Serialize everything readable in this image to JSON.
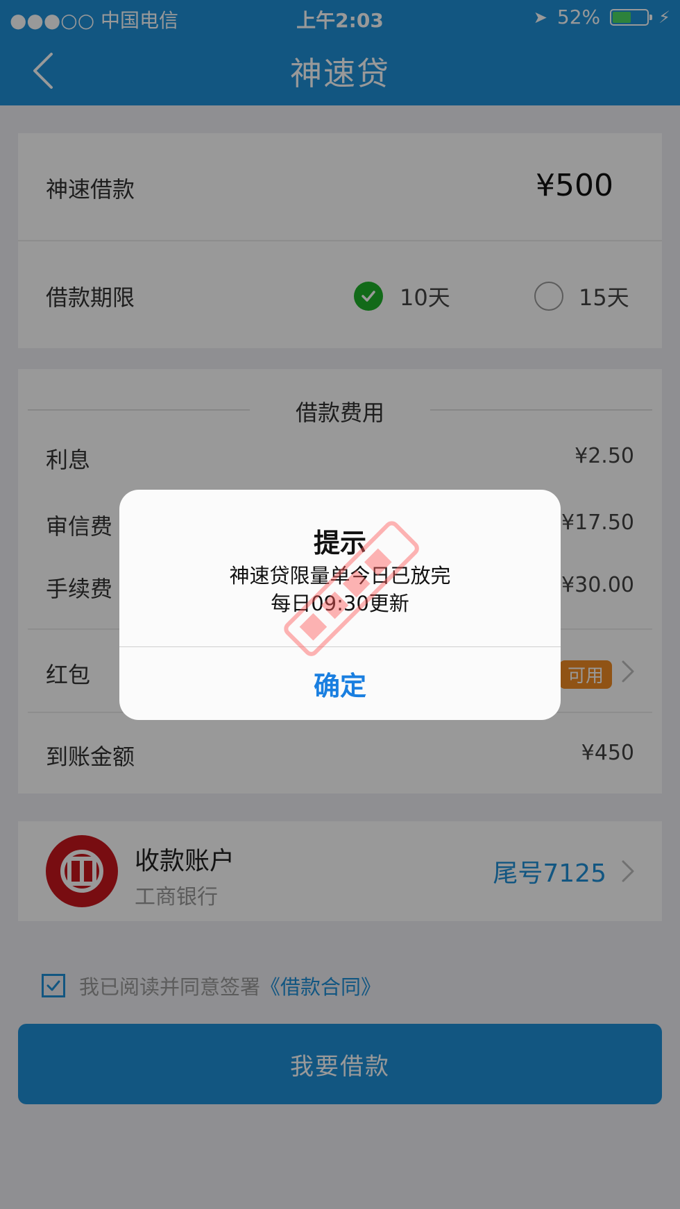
{
  "status_bar": {
    "carrier": "●●●○○ 中国电信",
    "time": "上午2:03",
    "battery": "52%"
  },
  "nav": {
    "title": "神速贷"
  },
  "loan": {
    "amount_label": "神速借款",
    "amount_value": "¥500",
    "term_label": "借款期限",
    "term_options": [
      {
        "label": "10天",
        "selected": true
      },
      {
        "label": "15天",
        "selected": false
      }
    ]
  },
  "fees": {
    "title": "借款费用",
    "items": [
      {
        "label": "利息",
        "value": "¥2.50"
      },
      {
        "label": "审信费",
        "value": "¥17.50"
      },
      {
        "label": "手续费",
        "value": "¥30.00"
      }
    ],
    "red_packet_label": "红包",
    "red_packet_badge": "可用",
    "received_label": "到账金额",
    "received_value": "¥450"
  },
  "account": {
    "title": "收款账户",
    "bank": "工商银行",
    "tail": "尾号7125"
  },
  "agreement": {
    "text": "我已阅读并同意签署",
    "link": "《借款合同》"
  },
  "submit_label": "我要借款",
  "dialog": {
    "title": "提示",
    "message_line1": "神速贷限量单今日已放完",
    "message_line2": "每日09:30更新",
    "confirm": "确定"
  },
  "colors": {
    "brand": "#1f8fd8",
    "check_green": "#1fb12a",
    "badge_orange": "#f08a23",
    "bank_red": "#c9161d"
  }
}
